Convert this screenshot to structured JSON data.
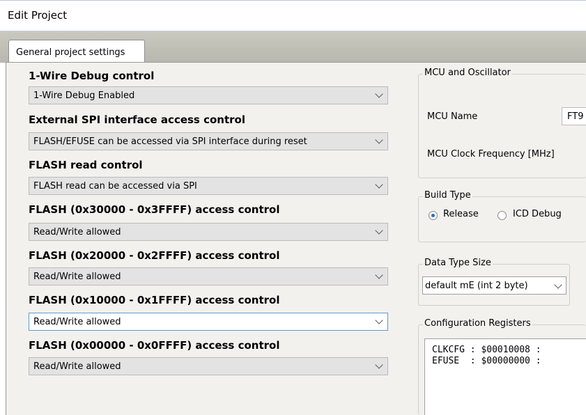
{
  "window": {
    "title": "Edit Project"
  },
  "tabs": [
    {
      "label": "General project settings"
    }
  ],
  "left": {
    "controls": [
      {
        "label": "1-Wire Debug control",
        "value": "1-Wire Debug Enabled"
      },
      {
        "label": "External SPI interface access control",
        "value": "FLASH/EFUSE can be accessed via SPI interface during reset"
      },
      {
        "label": "FLASH read control",
        "value": "FLASH read can be accessed via SPI"
      },
      {
        "label": "FLASH (0x30000 - 0x3FFFF) access control",
        "value": "Read/Write allowed"
      },
      {
        "label": "FLASH (0x20000 - 0x2FFFF) access control",
        "value": "Read/Write allowed"
      },
      {
        "label": "FLASH (0x10000 - 0x1FFFF) access control",
        "value": "Read/Write allowed"
      },
      {
        "label": "FLASH (0x00000 - 0x0FFFF) access control",
        "value": "Read/Write allowed"
      }
    ]
  },
  "right": {
    "mcu": {
      "legend": "MCU and Oscillator",
      "name_label": "MCU Name",
      "name_value": "FT9",
      "freq_label": "MCU Clock Frequency [MHz]"
    },
    "build": {
      "legend": "Build Type",
      "option_release": "Release",
      "option_icd": "ICD Debug",
      "selected": "Release"
    },
    "data_type": {
      "legend": "Data Type Size",
      "value": "default mE (int 2 byte)"
    },
    "config": {
      "legend": "Configuration Registers",
      "lines": [
        "CLKCFG : $00010008 :",
        "EFUSE  : $00000000 :"
      ]
    }
  }
}
